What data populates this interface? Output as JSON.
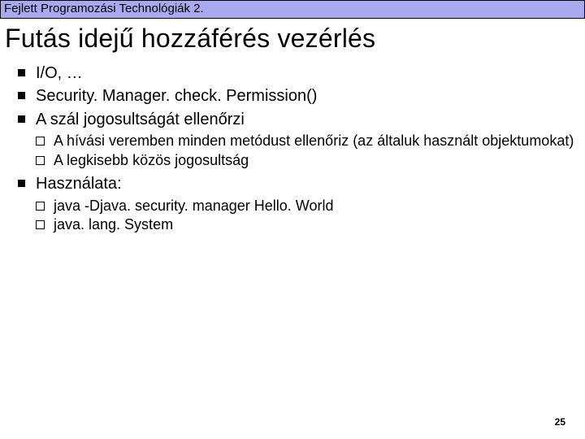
{
  "header": {
    "text": "Fejlett Programozási Technológiák 2."
  },
  "title": "Futás idejű hozzáférés vezérlés",
  "bullets": [
    {
      "text": "I/O, …"
    },
    {
      "text": "Security. Manager. check. Permission()"
    },
    {
      "text": "A szál jogosultságát ellenőrzi",
      "sub": [
        {
          "text": "A hívási veremben minden metódust ellenőriz (az általuk használt objektumokat)"
        },
        {
          "text": "A legkisebb közös jogosultság"
        }
      ]
    },
    {
      "text": "Használata:",
      "sub": [
        {
          "text": "java -Djava. security. manager Hello. World"
        },
        {
          "text": "java. lang. System"
        }
      ]
    }
  ],
  "page_number": "25"
}
